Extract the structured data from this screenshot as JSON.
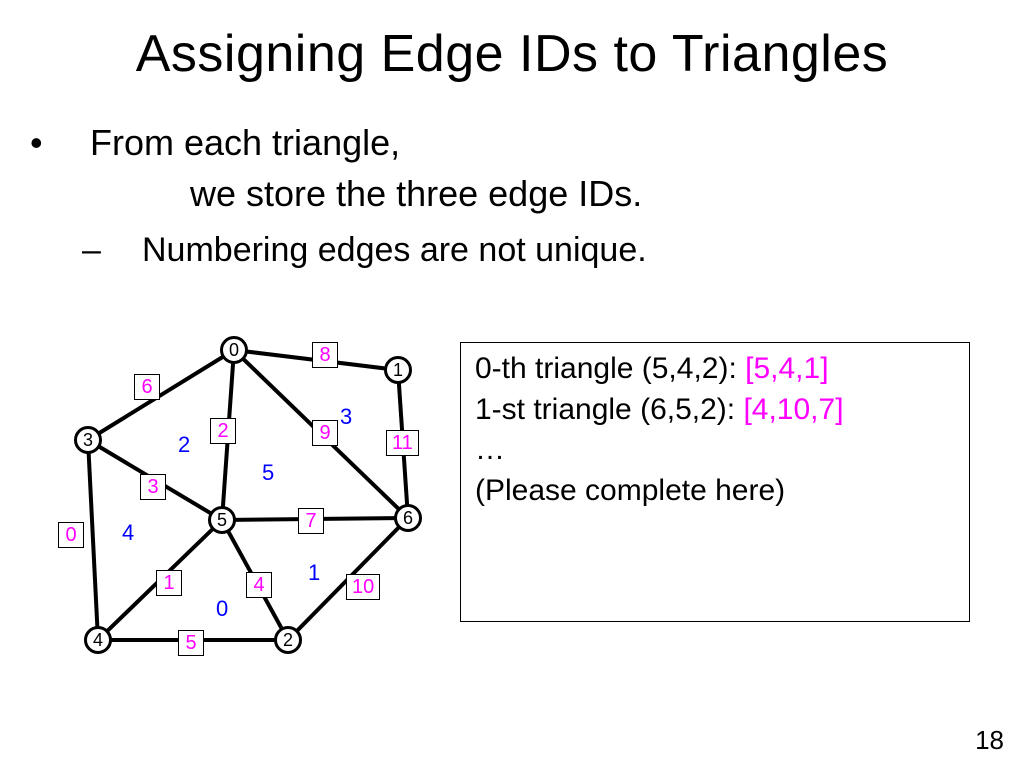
{
  "title": "Assigning Edge IDs to Triangles",
  "bullet1_line1": "From each triangle,",
  "bullet1_line2": "we store the three edge IDs.",
  "bullet2": "Numbering edges are not unique.",
  "info": {
    "line0_a": "0-th triangle (5,4,2): ",
    "line0_b": "[5,4,1]",
    "line1_a": "1-st triangle (6,5,2): ",
    "line1_b": "[4,10,7]",
    "ellipsis": "…",
    "note": "(Please complete here)"
  },
  "nodes": {
    "n0": "0",
    "n1": "1",
    "n2": "2",
    "n3": "3",
    "n4": "4",
    "n5": "5",
    "n6": "6"
  },
  "edges": {
    "e0": "0",
    "e1": "1",
    "e2": "2",
    "e3": "3",
    "e4": "4",
    "e5": "5",
    "e6": "6",
    "e7": "7",
    "e8": "8",
    "e9": "9",
    "e10": "10",
    "e11": "11"
  },
  "faces": {
    "f0": "0",
    "f1": "1",
    "f2": "2",
    "f3": "3",
    "f4": "4",
    "f5": "5"
  },
  "pagenum": "18"
}
